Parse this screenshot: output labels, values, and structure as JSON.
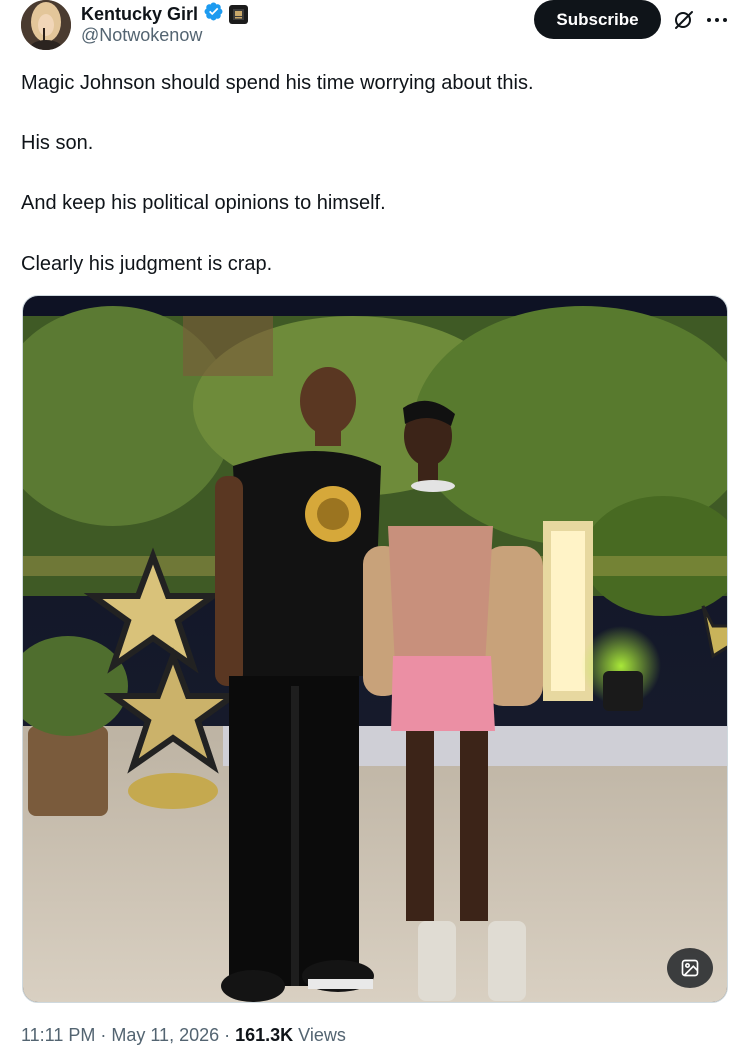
{
  "author": {
    "display_name": "Kentucky Girl",
    "handle": "@Notwokenow",
    "verified_icon": "verified-badge-icon",
    "affiliate_icon": "affiliate-badge-icon"
  },
  "actions": {
    "subscribe_label": "Subscribe",
    "grok_icon": "grok-icon",
    "more_icon": "more-icon"
  },
  "tweet": {
    "lines": [
      "Magic Johnson should spend his time worrying about this.",
      "His son.",
      "And keep his political opinions to himself.",
      "Clearly his judgment is crap."
    ]
  },
  "media": {
    "gif_button_icon": "image-edit-icon"
  },
  "meta": {
    "time": "11:11 PM",
    "separator": "·",
    "date": "May 11, 2026",
    "views_count": "161.3K",
    "views_label": "Views"
  },
  "colors": {
    "text": "#0f1419",
    "secondary": "#536471",
    "verified": "#1d9bf0",
    "button": "#0f1419"
  }
}
